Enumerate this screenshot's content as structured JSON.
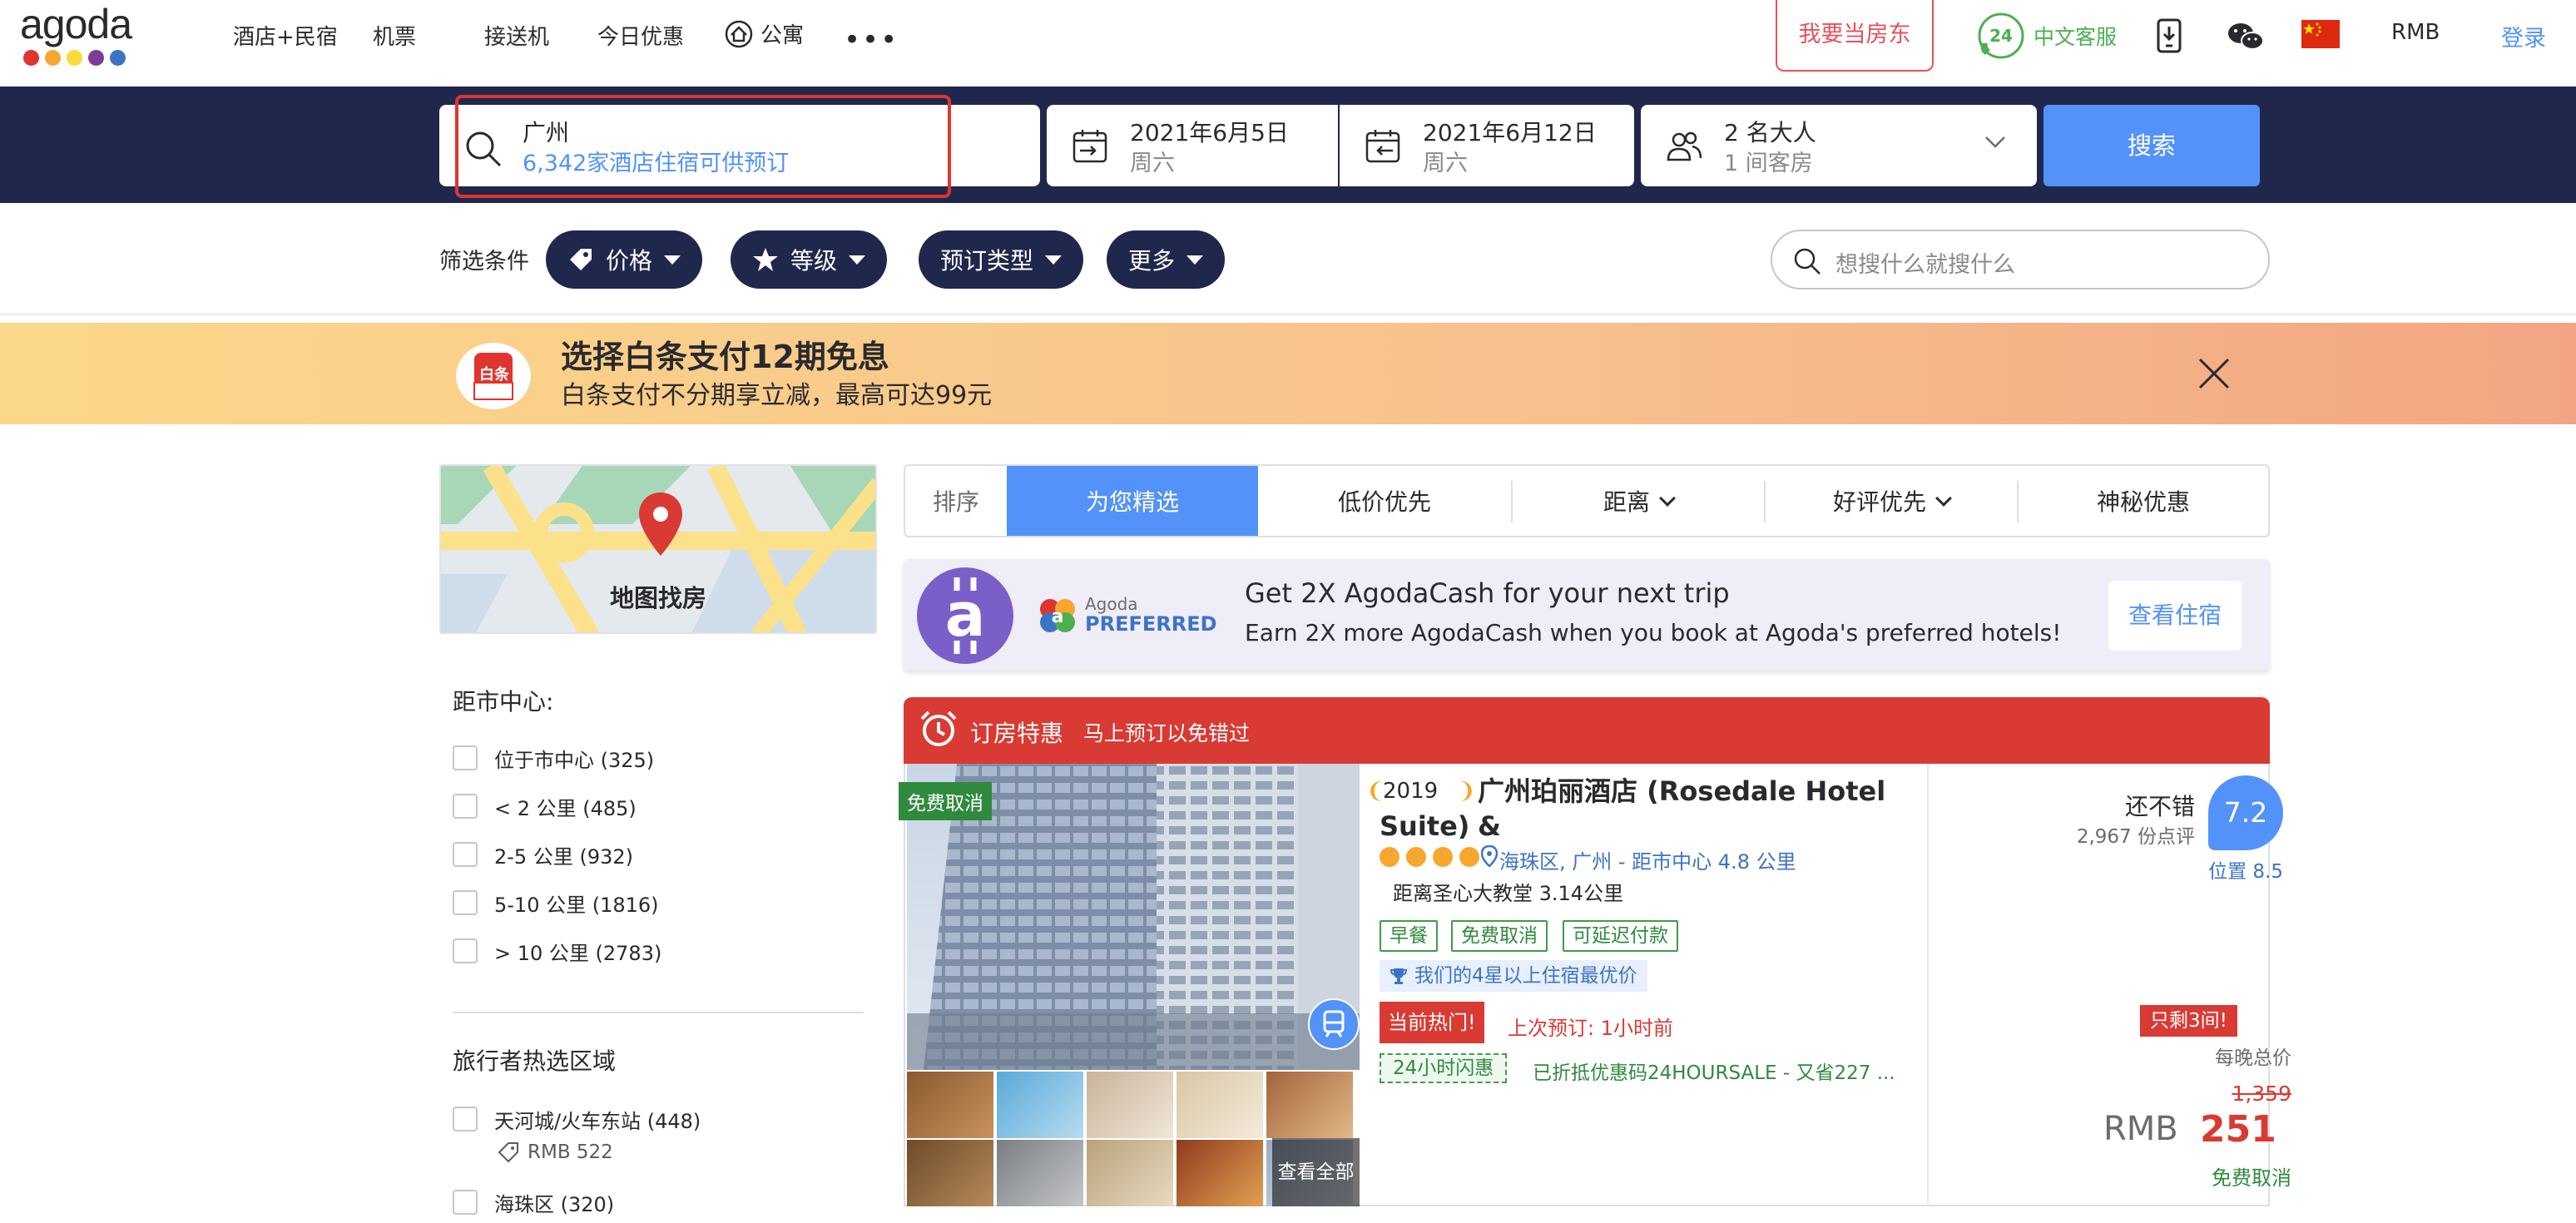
{
  "nav": {
    "logo_text": "agoda",
    "logo_dot_colors": [
      "#e0342f",
      "#f7a72e",
      "#fcd93b",
      "#7d3c98",
      "#3d73c7"
    ],
    "items": [
      "酒店+民宿",
      "机票",
      "接送机",
      "今日优惠",
      "公寓"
    ],
    "more": "•••",
    "host_label": "我要当房东",
    "cs_label": "中文客服",
    "cs_badge": "24",
    "currency": "RMB",
    "login": "登录"
  },
  "search": {
    "city": "广州",
    "city_sub": "6,342家酒店住宿可供预订",
    "checkin": "2021年6月5日",
    "checkin_day": "周六",
    "checkout": "2021年6月12日",
    "checkout_day": "周六",
    "guests": "2 名大人",
    "rooms": "1 间客房",
    "button": "搜索"
  },
  "filters": {
    "label": "筛选条件",
    "pills": [
      "价格",
      "等级",
      "预订类型",
      "更多"
    ],
    "keyword_placeholder": "想搜什么就搜什么"
  },
  "banner": {
    "logo_text": "白条",
    "title": "选择白条支付12期免息",
    "subtitle": "白条支付不分期享立减，最高可达99元"
  },
  "sidebar": {
    "map_label": "地图找房",
    "distance_heading": "距市中心:",
    "distance_options": [
      "位于市中心 (325)",
      "< 2 公里 (485)",
      "2-5 公里 (932)",
      "5-10 公里 (1816)",
      "> 10 公里 (2783)"
    ],
    "area_heading": "旅行者热选区域",
    "areas": [
      {
        "label": "天河城/火车东站 (448)",
        "price": "RMB 522"
      },
      {
        "label": "海珠区 (320)"
      }
    ]
  },
  "sort": {
    "label": "排序",
    "options": [
      "为您精选",
      "低价优先",
      "距离",
      "好评优先",
      "神秘优惠"
    ]
  },
  "promo": {
    "brand_top": "Agoda",
    "brand_bottom": "PREFERRED",
    "title": "Get 2X AgodaCash for your next trip",
    "subtitle": "Earn 2X more AgodaCash when you book at Agoda's preferred hotels!",
    "button": "查看住宿"
  },
  "hotel": {
    "deal_title": "订房特惠",
    "deal_sub": "马上预订以免错过",
    "free_cancel_tag": "免费取消",
    "see_all": "查看全部",
    "year": "2019",
    "name_line1": "广州珀丽酒店 (Rosedale Hotel &",
    "name_line2": "Suite)",
    "star_rating": 4,
    "location": "海珠区, 广州 - 距市中心 4.8 公里",
    "landmark": "距离圣心大教堂 3.14公里",
    "tags": [
      "早餐",
      "免费取消",
      "可延迟付款"
    ],
    "best_price": "我们的4星以上住宿最优价",
    "hot_tag": "当前热门!",
    "last_booked": "上次预订: 1小时前",
    "flash_tag": "24小时闪惠",
    "flash_text": "已折抵优惠码24HOURSALE - 又省227 ...",
    "review_word": "还不错",
    "review_count": "2,967 份点评",
    "score": "7.2",
    "location_score": "位置 8.5",
    "rooms_left": "只剩3间!",
    "per_night": "每晚总价",
    "old_price": "1,359",
    "currency": "RMB",
    "price": "251",
    "price_note": "免费取消"
  },
  "colors": {
    "nav_dark": "#20274d",
    "accent_blue": "#5392f9",
    "deal_red": "#d93a33",
    "green": "#2f8a3e"
  }
}
